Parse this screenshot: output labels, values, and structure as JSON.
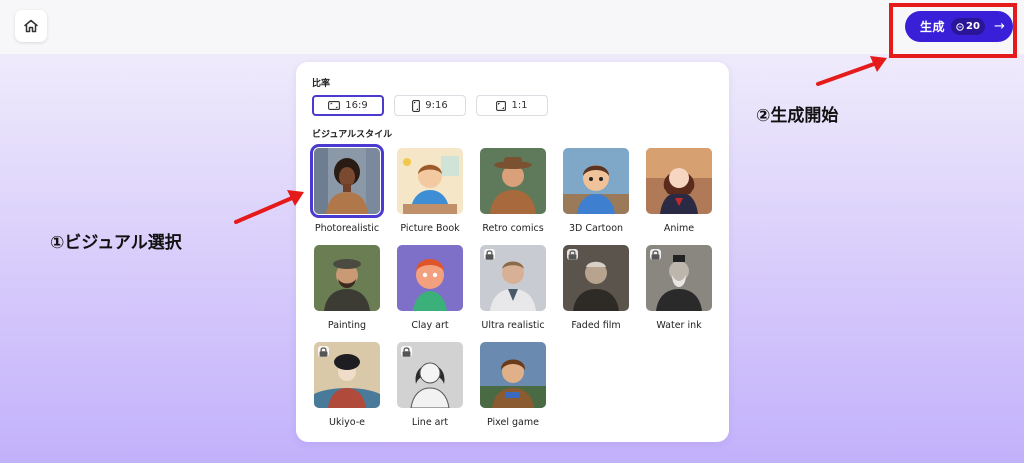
{
  "topbar": {
    "home_icon": "home-icon",
    "generate": {
      "label": "生成",
      "credits": "20",
      "coin_icon": "coin-icon",
      "arrow_icon": "arrow-right-icon"
    }
  },
  "panel": {
    "ratio_title": "比率",
    "ratios": [
      {
        "label": "16:9",
        "icon": "landscape-ratio-icon",
        "selected": true
      },
      {
        "label": "9:16",
        "icon": "portrait-ratio-icon",
        "selected": false
      },
      {
        "label": "1:1",
        "icon": "square-ratio-icon",
        "selected": false
      }
    ],
    "style_title": "ビジュアルスタイル",
    "styles": [
      {
        "label": "Photorealistic",
        "locked": false,
        "selected": true
      },
      {
        "label": "Picture Book",
        "locked": false,
        "selected": false
      },
      {
        "label": "Retro comics",
        "locked": false,
        "selected": false
      },
      {
        "label": "3D Cartoon",
        "locked": false,
        "selected": false
      },
      {
        "label": "Anime",
        "locked": false,
        "selected": false
      },
      {
        "label": "Painting",
        "locked": false,
        "selected": false
      },
      {
        "label": "Clay art",
        "locked": false,
        "selected": false
      },
      {
        "label": "Ultra realistic",
        "locked": true,
        "selected": false
      },
      {
        "label": "Faded film",
        "locked": true,
        "selected": false
      },
      {
        "label": "Water ink",
        "locked": true,
        "selected": false
      },
      {
        "label": "Ukiyo-e",
        "locked": true,
        "selected": false
      },
      {
        "label": "Line art",
        "locked": true,
        "selected": false
      },
      {
        "label": "Pixel game",
        "locked": false,
        "selected": false
      }
    ]
  },
  "annotations": {
    "step1": "①ビジュアル選択",
    "step2": "②生成開始",
    "highlight_color": "#e51a1a",
    "accent_color": "#3a1fd9"
  }
}
